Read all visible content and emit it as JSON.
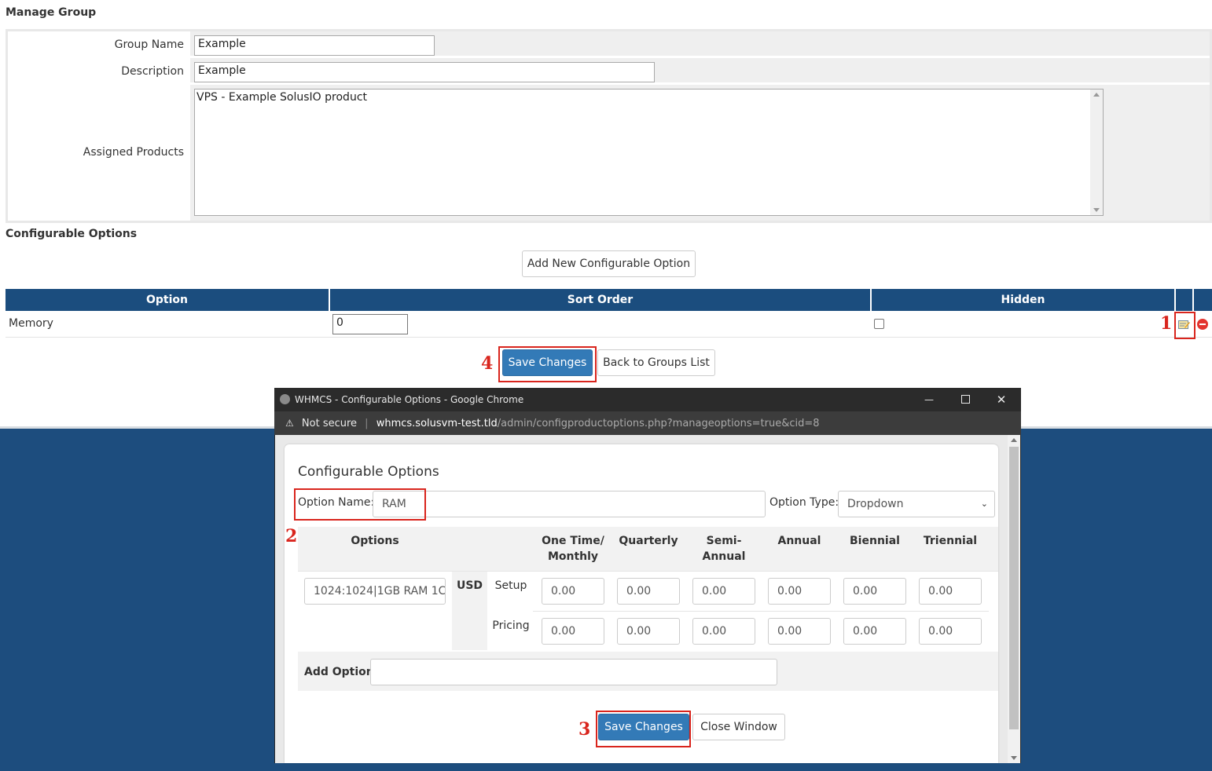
{
  "manage_group": {
    "title": "Manage Group",
    "group_name_label": "Group Name",
    "group_name_value": "Example",
    "description_label": "Description",
    "description_value": "Example",
    "assigned_products_label": "Assigned Products",
    "assigned_products": [
      "VPS - Example SolusIO product"
    ]
  },
  "configurable": {
    "title": "Configurable Options",
    "add_button": "Add New Configurable Option",
    "columns": [
      "Option",
      "Sort Order",
      "Hidden"
    ],
    "rows": [
      {
        "option": "Memory",
        "sort_order": "0",
        "hidden": false
      }
    ],
    "edit_icon": "edit-icon",
    "delete_icon": "delete-icon",
    "save_button": "Save Changes",
    "back_button": "Back to Groups List"
  },
  "markers": {
    "m1": "1",
    "m2": "2",
    "m3": "3",
    "m4": "4"
  },
  "popup": {
    "window_title": "WHMCS - Configurable Options - Google Chrome",
    "security_label": "Not secure",
    "url_host": "whmcs.solusvm-test.tld",
    "url_path": "/admin/configproductoptions.php?manageoptions=true&cid=8",
    "heading": "Configurable Options",
    "option_name_label": "Option Name:",
    "option_name_value": "RAM",
    "option_type_label": "Option Type:",
    "option_type_value": "Dropdown",
    "options_header": "Options",
    "period_headers": [
      "One Time/ Monthly",
      "Quarterly",
      "Semi- Annual",
      "Annual",
      "Biennial",
      "Triennial"
    ],
    "option_value": "1024:1024|1GB RAM 1C",
    "currency": "USD",
    "setup_label": "Setup",
    "pricing_label": "Pricing",
    "setup_prices": [
      "0.00",
      "0.00",
      "0.00",
      "0.00",
      "0.00",
      "0.00"
    ],
    "pricing_prices": [
      "0.00",
      "0.00",
      "0.00",
      "0.00",
      "0.00",
      "0.00"
    ],
    "add_option_label": "Add Option:",
    "save_button": "Save Changes",
    "close_button": "Close Window"
  }
}
